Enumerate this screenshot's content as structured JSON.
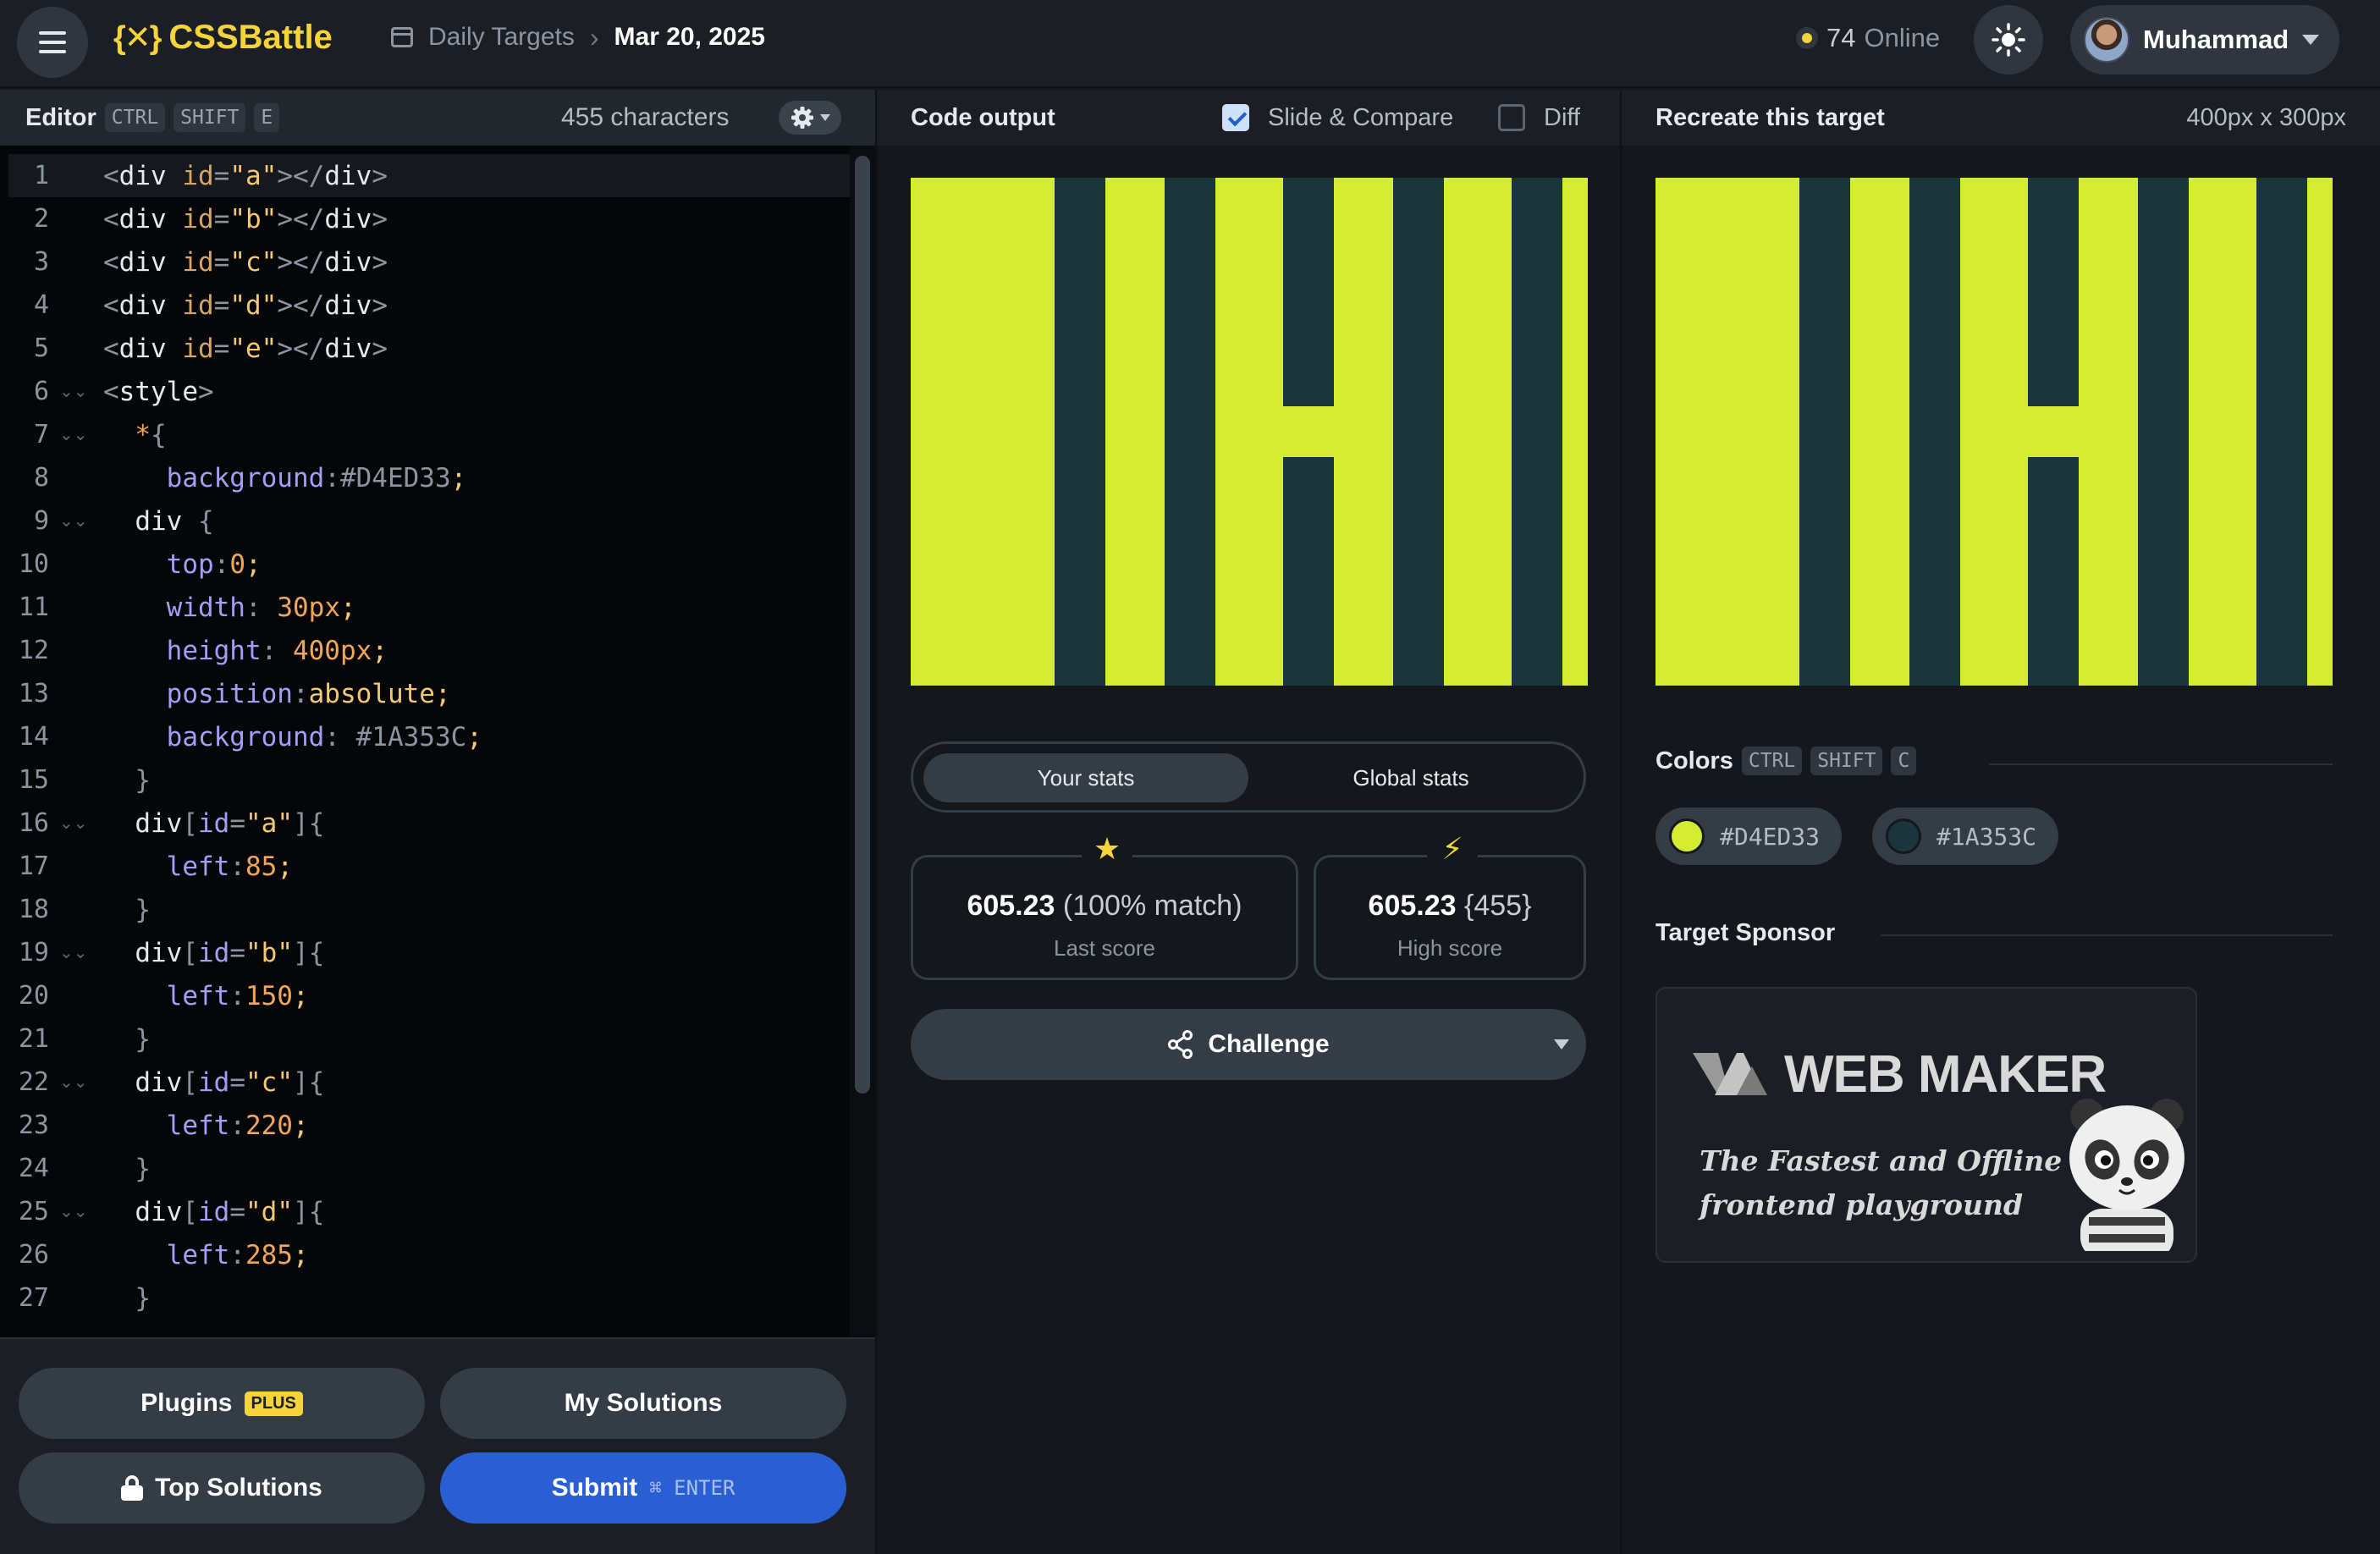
{
  "header": {
    "brand": "CSSBattle",
    "brand_mark": "{✕}",
    "breadcrumb_section": "Daily Targets",
    "breadcrumb_date": "Mar 20, 2025",
    "online_count": "74",
    "online_label": "Online",
    "user_name": "Muhammad"
  },
  "editor": {
    "title": "Editor",
    "shortcut": [
      "CTRL",
      "SHIFT",
      "E"
    ],
    "char_count": "455 characters",
    "lines": [
      {
        "n": "1"
      },
      {
        "n": "2"
      },
      {
        "n": "3"
      },
      {
        "n": "4"
      },
      {
        "n": "5"
      },
      {
        "n": "6"
      },
      {
        "n": "7"
      },
      {
        "n": "8"
      },
      {
        "n": "9"
      },
      {
        "n": "10"
      },
      {
        "n": "11"
      },
      {
        "n": "12"
      },
      {
        "n": "13"
      },
      {
        "n": "14"
      },
      {
        "n": "15"
      },
      {
        "n": "16"
      },
      {
        "n": "17"
      },
      {
        "n": "18"
      },
      {
        "n": "19"
      },
      {
        "n": "20"
      },
      {
        "n": "21"
      },
      {
        "n": "22"
      },
      {
        "n": "23"
      },
      {
        "n": "24"
      },
      {
        "n": "25"
      },
      {
        "n": "26"
      },
      {
        "n": "27"
      }
    ],
    "buttons": {
      "plugins": "Plugins",
      "plugins_badge": "PLUS",
      "my_solutions": "My Solutions",
      "top_solutions": "Top Solutions",
      "submit": "Submit",
      "submit_shortcut": "⌘ ENTER"
    }
  },
  "output": {
    "title": "Code output",
    "slide_compare": "Slide & Compare",
    "diff": "Diff",
    "tabs": {
      "yours": "Your stats",
      "global": "Global stats"
    },
    "last_score": {
      "value": "605.23",
      "detail": "(100% match)",
      "label": "Last score"
    },
    "high_score": {
      "value": "605.23",
      "detail": "{455}",
      "label": "High score"
    },
    "challenge": "Challenge"
  },
  "target": {
    "title": "Recreate this target",
    "size": "400px x 300px",
    "colors_title": "Colors",
    "colors_shortcut": [
      "CTRL",
      "SHIFT",
      "C"
    ],
    "colors": [
      {
        "label": "#D4ED33",
        "hex": "#D4ED33"
      },
      {
        "label": "#1A353C",
        "hex": "#1A353C"
      }
    ],
    "sponsor_title": "Target Sponsor",
    "sponsor_name": "WEB MAKER",
    "sponsor_tagline": "The Fastest and Offline frontend playground"
  },
  "colors": {
    "accent_yellow": "#F5D43B",
    "submit_blue": "#2A5FD4",
    "target_light": "#D4ED33",
    "target_dark": "#1A353C"
  }
}
